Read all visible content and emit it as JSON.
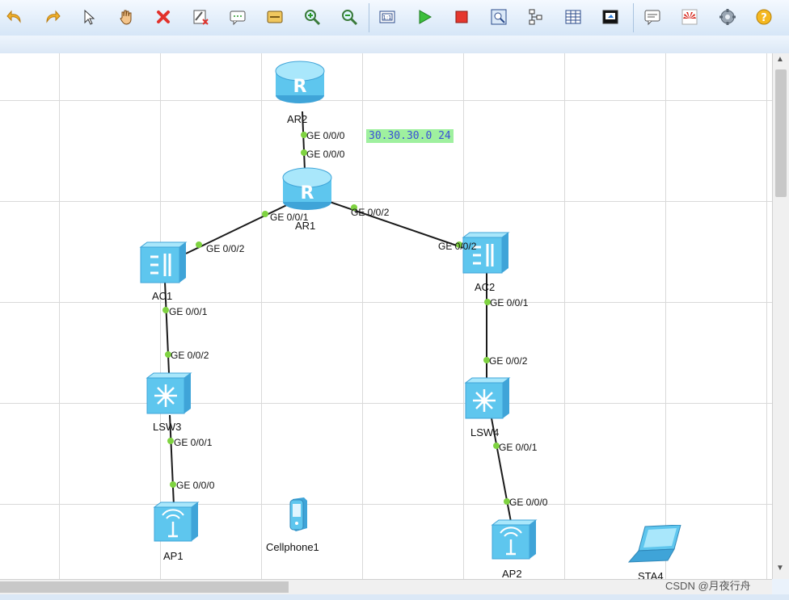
{
  "toolbar": {
    "buttons": [
      "undo-icon",
      "redo-icon",
      "select-icon",
      "hand-icon",
      "delete-icon",
      "clear-icon",
      "text-icon",
      "rectangle-icon",
      "zoom-in-icon",
      "zoom-out-icon",
      "fit-icon",
      "start-icon",
      "stop-icon",
      "capture-icon",
      "topology-icon",
      "grid-icon",
      "console-icon",
      "message-icon",
      "huawei-icon",
      "settings-icon",
      "help-icon"
    ]
  },
  "devices": {
    "ar2": "AR2",
    "ar1": "AR1",
    "ac1": "AC1",
    "ac2": "AC2",
    "lsw3": "LSW3",
    "lsw4": "LSW4",
    "ap1": "AP1",
    "ap2": "AP2",
    "cellphone": "Cellphone1",
    "sta": "STA4"
  },
  "ports": {
    "ar2_ge000": "GE 0/0/0",
    "ar1_ge000": "GE 0/0/0",
    "ar1_ge001": "GE 0/0/1",
    "ar1_ge002": "GE 0/0/2",
    "ac1_ge002": "GE 0/0/2",
    "ac1_ge001": "GE 0/0/1",
    "lsw3_ge002": "GE 0/0/2",
    "lsw3_ge001": "GE 0/0/1",
    "ap1_ge000": "GE 0/0/0",
    "ac2_ge002": "GE 0/0/2",
    "ac2_ge001": "GE 0/0/1",
    "lsw4_ge002": "GE 0/0/2",
    "lsw4_ge001": "GE 0/0/1",
    "ap2_ge000": "GE 0/0/0"
  },
  "note": "30.30.30.0 24",
  "watermark": "CSDN @月夜行舟",
  "colors": {
    "port_dot": "#7fd341",
    "device_blue": "#5ec6ee",
    "note_bg": "#9ff09f"
  }
}
